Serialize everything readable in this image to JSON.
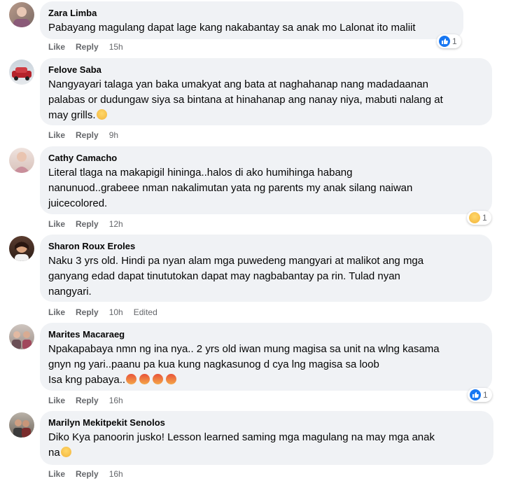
{
  "comments": [
    {
      "author": "Zara Limba",
      "lines": [
        "Pabayang magulang dapat lage kang nakabantay sa anak mo Lalonat ito maliit"
      ],
      "actions": {
        "like": "Like",
        "reply": "Reply",
        "time": "15h",
        "edited": ""
      },
      "reaction": {
        "type": "like-icon",
        "count": "1"
      }
    },
    {
      "author": "Felove Saba",
      "lines": [
        "Nangyayari talaga yan baka umakyat ang bata at naghahanap nang madadaanan",
        "palabas or dudungaw siya sa bintana at hinahanap ang nanay niya, mabuti nalang at",
        "may grills."
      ],
      "actions": {
        "like": "Like",
        "reply": "Reply",
        "time": "9h",
        "edited": ""
      }
    },
    {
      "author": "Cathy Camacho",
      "lines": [
        "Literal tlaga na makapigil hininga..halos di ako humihinga habang",
        "nanunuod..grabeee nman nakalimutan yata ng parents my anak silang naiwan",
        "juicecolored."
      ],
      "actions": {
        "like": "Like",
        "reply": "Reply",
        "time": "12h",
        "edited": ""
      },
      "reaction": {
        "type": "sad-reaction-icon",
        "count": "1"
      }
    },
    {
      "author": "Sharon Roux Eroles",
      "lines": [
        "Naku 3 yrs old. Hindi pa nyan alam mga puwedeng mangyari at malikot ang mga",
        "ganyang edad dapat tinututokan dapat may nagbabantay pa rin. Tulad nyan",
        "nangyari."
      ],
      "actions": {
        "like": "Like",
        "reply": "Reply",
        "time": "10h",
        "edited": "Edited"
      }
    },
    {
      "author": "Marites Macaraeg",
      "lines": [
        "Npakapabaya nmn ng ina nya.. 2 yrs old iwan mung magisa sa unit na wlng kasama",
        "gnyn ng yari..paanu pa kua kung nagkasunog d cya lng magisa sa loob",
        "Isa kng pabaya.."
      ],
      "actions": {
        "like": "Like",
        "reply": "Reply",
        "time": "16h",
        "edited": ""
      },
      "reaction": {
        "type": "like-icon",
        "count": "1"
      }
    },
    {
      "author": "Marilyn Mekitpekit Senolos",
      "lines": [
        "Diko Kya panoorin jusko! Lesson learned saming mga magulang na may mga anak",
        "na"
      ],
      "actions": {
        "like": "Like",
        "reply": "Reply",
        "time": "16h",
        "edited": ""
      }
    }
  ],
  "colors": {
    "bubble": "#f0f2f5",
    "secondary_text": "#65676b",
    "like_blue": "#1877f2"
  }
}
